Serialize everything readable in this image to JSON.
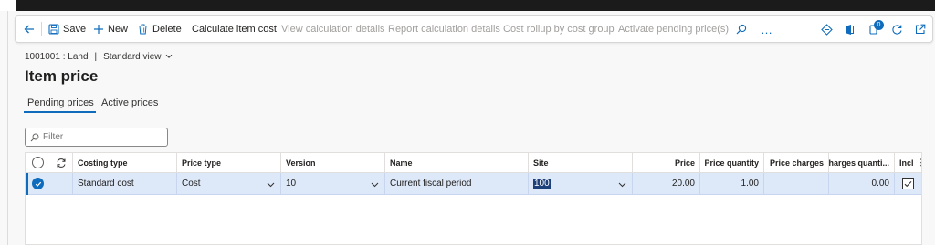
{
  "toolbar": {
    "save_label": "Save",
    "new_label": "New",
    "delete_label": "Delete",
    "calc_item_cost_label": "Calculate item cost",
    "view_calc_details_label": "View calculation details",
    "report_calc_details_label": "Report calculation details",
    "cost_rollup_label": "Cost rollup by cost group",
    "activate_pending_label": "Activate pending price(s)",
    "more_label": "…",
    "notification_count": "0"
  },
  "breadcrumb": {
    "item": "1001001 : Land",
    "separator": "|",
    "view": "Standard view"
  },
  "page": {
    "title": "Item price"
  },
  "tabs": [
    {
      "label": "Pending prices",
      "active": true
    },
    {
      "label": "Active prices",
      "active": false
    }
  ],
  "filter": {
    "placeholder": "Filter"
  },
  "grid": {
    "headers": {
      "costing_type": "Costing type",
      "price_type": "Price type",
      "version": "Version",
      "name": "Name",
      "site": "Site",
      "price": "Price",
      "price_quantity": "Price quantity",
      "price_charges": "Price charges",
      "charges_quantity": "Charges quanti...",
      "incl": "Incl"
    },
    "rows": [
      {
        "costing_type": "Standard cost",
        "price_type": "Cost",
        "version": "10",
        "name": "Current fiscal period",
        "site": "100",
        "price": "20.00",
        "price_quantity": "1.00",
        "price_charges": "",
        "charges_quantity": "0.00",
        "incl": true
      }
    ]
  },
  "colors": {
    "accent": "#0f6cbd",
    "selected_row": "#dde8f8"
  }
}
